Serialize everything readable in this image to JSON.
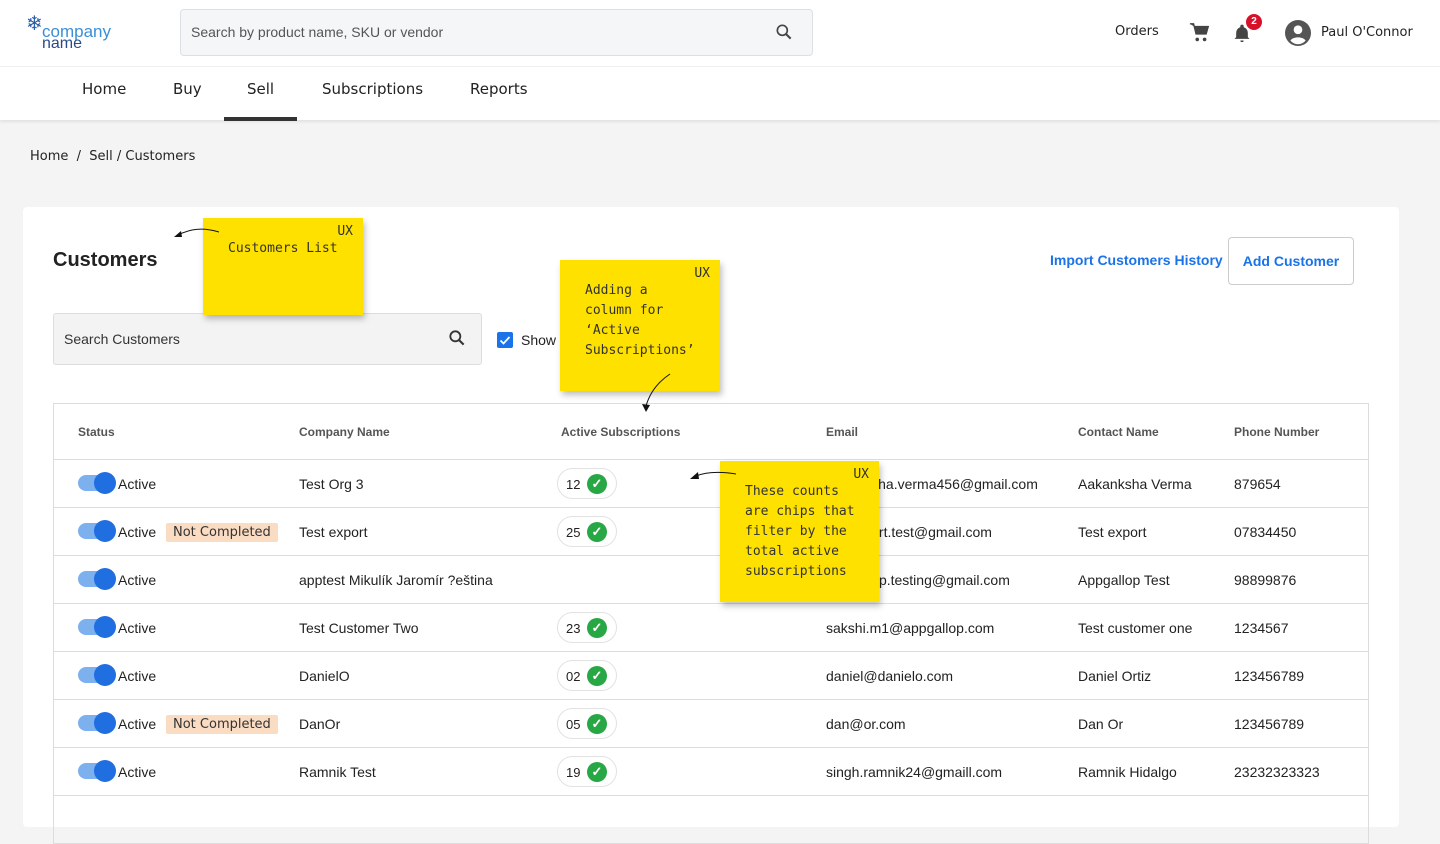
{
  "logo": {
    "line1": "company",
    "line2": "name"
  },
  "search": {
    "placeholder": "Search by product name, SKU or vendor"
  },
  "header": {
    "orders": "Orders",
    "notification_count": "2",
    "user_name": "Paul O'Connor"
  },
  "nav": [
    "Home",
    "Buy",
    "Sell",
    "Subscriptions",
    "Reports"
  ],
  "breadcrumb": "Home  /  Sell / Customers",
  "page": {
    "title": "Customers",
    "import_link": "Import Customers History",
    "add_button": "Add Customer",
    "search_placeholder": "Search Customers",
    "show_label": "Show"
  },
  "table": {
    "headers": [
      "Status",
      "Company Name",
      "Active Subscriptions",
      "Email",
      "Contact Name",
      "Phone Number"
    ],
    "rows": [
      {
        "status": "Active",
        "badge": "",
        "company": "Test Org 3",
        "subs": "12",
        "email": "aakanksha.verma456@gmail.com",
        "contact": "Aakanksha Verma",
        "phone": "879654"
      },
      {
        "status": "Active",
        "badge": "Not Completed",
        "company": "Test export",
        "subs": "25",
        "email": "testexport.test@gmail.com",
        "contact": "Test export",
        "phone": "07834450"
      },
      {
        "status": "Active",
        "badge": "",
        "company": "apptest Mikulík Jaromír ?eština",
        "subs": "",
        "email": "appgallop.testing@gmail.com",
        "contact": "Appgallop Test",
        "phone": "98899876"
      },
      {
        "status": "Active",
        "badge": "",
        "company": "Test Customer Two",
        "subs": "23",
        "email": "sakshi.m1@appgallop.com",
        "contact": "Test customer one",
        "phone": "1234567"
      },
      {
        "status": "Active",
        "badge": "",
        "company": "DanielO",
        "subs": "02",
        "email": "daniel@danielo.com",
        "contact": "Daniel Ortiz",
        "phone": "123456789"
      },
      {
        "status": "Active",
        "badge": "Not Completed",
        "company": "DanOr",
        "subs": "05",
        "email": "dan@or.com",
        "contact": "Dan Or",
        "phone": "123456789"
      },
      {
        "status": "Active",
        "badge": "",
        "company": "Ramnik Test",
        "subs": "19",
        "email": "singh.ramnik24@gmaill.com",
        "contact": "Ramnik Hidalgo",
        "phone": "23232323323"
      }
    ]
  },
  "notes": [
    {
      "tag": "UX",
      "text": "Customers List"
    },
    {
      "tag": "UX",
      "text": "Adding a\ncolumn for\n‘Active\nSubscriptions’"
    },
    {
      "tag": "UX",
      "text": "These counts\nare chips that\nfilter by the\ntotal active\nsubscriptions"
    }
  ]
}
